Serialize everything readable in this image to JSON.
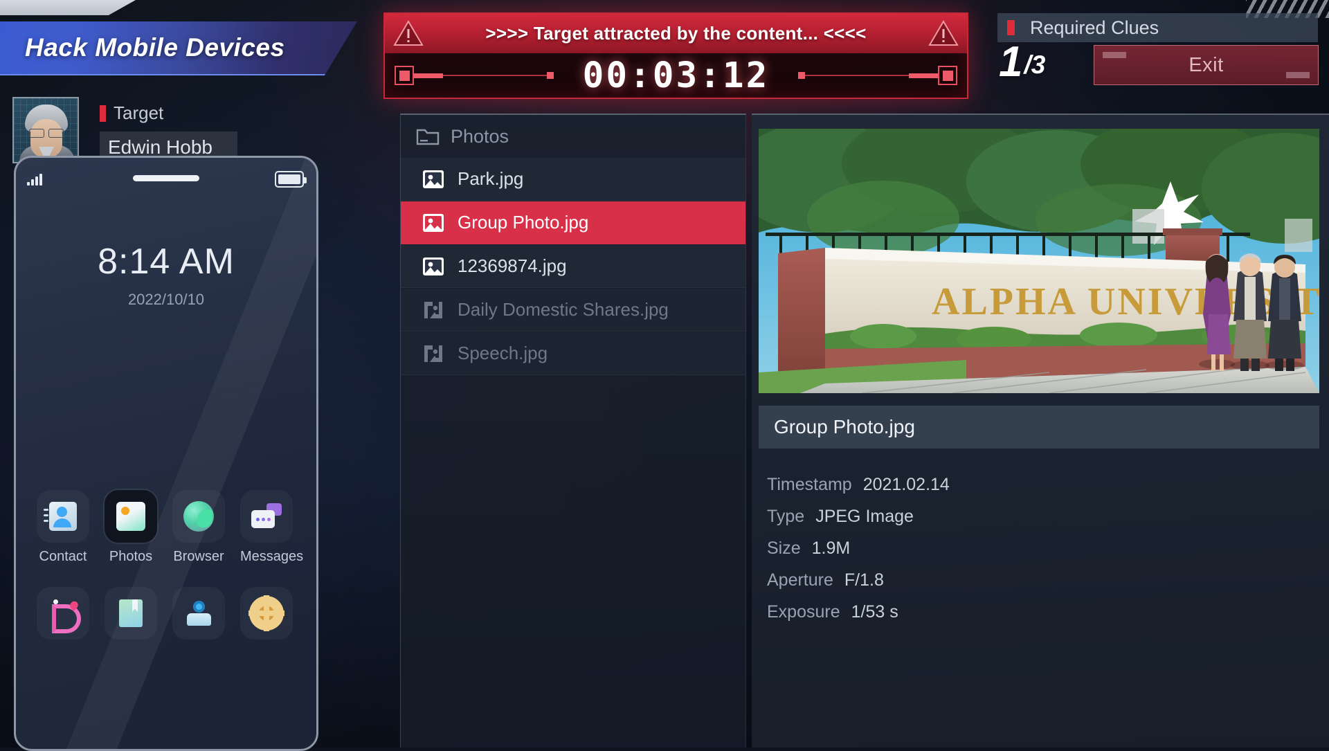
{
  "header": {
    "mission_title": "Hack Mobile Devices"
  },
  "target": {
    "label": "Target",
    "name": "Edwin Hobb",
    "avatar_icon": "suspect-portrait"
  },
  "phone": {
    "time": "8:14 AM",
    "date": "2022/10/10",
    "status_icons": [
      "signal-icon",
      "battery-icon"
    ],
    "apps_row1": [
      {
        "name": "Contact",
        "icon": "contacts-icon",
        "selected": false
      },
      {
        "name": "Photos",
        "icon": "photos-icon",
        "selected": true
      },
      {
        "name": "Browser",
        "icon": "browser-globe-icon",
        "selected": false
      },
      {
        "name": "Messages",
        "icon": "messages-icon",
        "selected": false
      }
    ],
    "apps_row2": [
      {
        "name": "",
        "icon": "music-icon",
        "selected": false
      },
      {
        "name": "",
        "icon": "book-icon",
        "selected": false
      },
      {
        "name": "",
        "icon": "profile-icon",
        "selected": false
      },
      {
        "name": "",
        "icon": "settings-gear-icon",
        "selected": false
      }
    ]
  },
  "alert": {
    "message": ">>>> Target attracted by the content... <<<<",
    "timer": "00:03:12",
    "warning_icon": "warning-triangle-icon",
    "accent_color": "#d3293c"
  },
  "clues": {
    "label": "Required Clues",
    "current": "1",
    "total": "/3",
    "exit_label": "Exit"
  },
  "files": {
    "folder_label": "Photos",
    "folder_icon": "folder-icon",
    "items": [
      {
        "name": "Park.jpg",
        "icon": "image-file-icon",
        "state": "normal"
      },
      {
        "name": "Group Photo.jpg",
        "icon": "image-file-icon",
        "state": "selected"
      },
      {
        "name": "12369874.jpg",
        "icon": "image-file-icon",
        "state": "normal"
      },
      {
        "name": "Daily Domestic Shares.jpg",
        "icon": "corrupted-file-icon",
        "state": "locked"
      },
      {
        "name": "Speech.jpg",
        "icon": "corrupted-file-icon",
        "state": "locked"
      }
    ]
  },
  "preview": {
    "photo_alt": "Three people standing beside the ALPHA UNIVERSITY entrance sign",
    "sign_text": "ALPHA UNIVERSITY",
    "title": "Group Photo.jpg",
    "metadata": [
      {
        "key": "Timestamp",
        "value": "2021.02.14"
      },
      {
        "key": "Type",
        "value": "JPEG Image"
      },
      {
        "key": "Size",
        "value": "1.9M"
      },
      {
        "key": "Aperture",
        "value": "F/1.8"
      },
      {
        "key": "Exposure",
        "value": "1/53 s"
      }
    ]
  }
}
